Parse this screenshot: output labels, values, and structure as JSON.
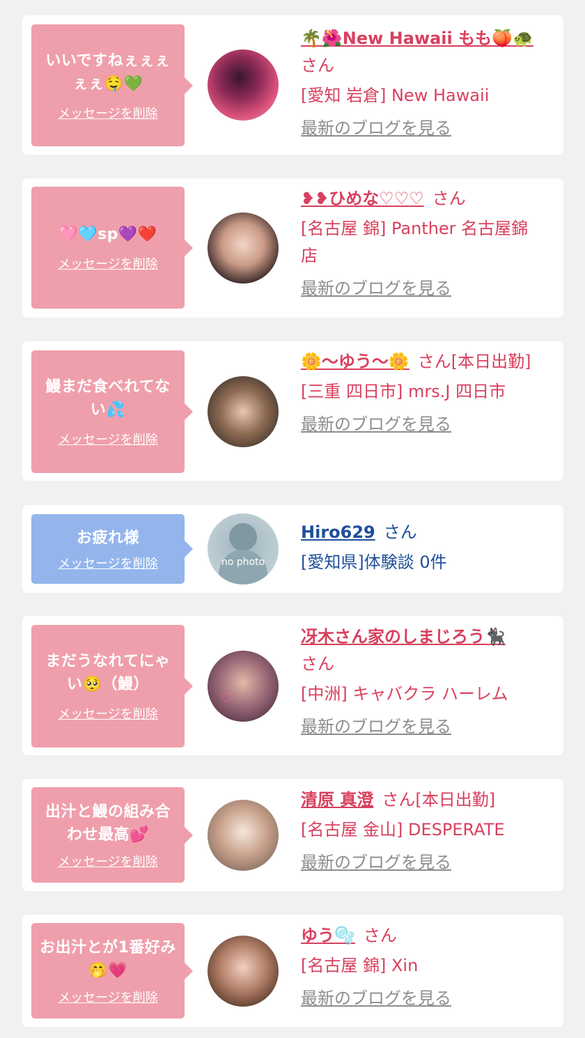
{
  "delete_label": "メッセージを削除",
  "blog_label": "最新のブログを見る",
  "san_label": "さん",
  "cards": [
    {
      "message": "いいですねぇぇぇぇぇ🤤💚",
      "name": "🌴🌺New Hawaii もも🍑🐢",
      "suffix": "さん",
      "shop": "[愛知 岩倉] New Hawaii",
      "bubble_color": "#ef9fab"
    },
    {
      "message": "🩷🩵sp💜❤️",
      "name": "❥❥ひめな♡♡♡",
      "suffix": "さん",
      "shop": "[名古屋 錦] Panther 名古屋錦店",
      "bubble_color": "#ef9fab"
    },
    {
      "message": "鰻まだ食べれてない💦",
      "name": "🌼〜ゆう〜🌼",
      "suffix": "さん[本日出勤]",
      "shop": "[三重 四日市] mrs.J 四日市",
      "bubble_color": "#ef9fab"
    },
    {
      "message": "お疲れ様",
      "name": "Hiro629",
      "suffix": "さん",
      "shop": "[愛知県]体験談 0件",
      "bubble_color": "#93b5ec",
      "avatar_text": "no photo"
    },
    {
      "message": "まだうなれてにゃい🥺（鰻）",
      "name": "冴木さん家のしまじろう🐈‍⬛",
      "suffix": "さん",
      "shop": "[中洲] キャバクラ ハーレム",
      "bubble_color": "#ef9fab"
    },
    {
      "message": "出汁と鰻の組み合わせ最高💕",
      "name": "清原 真澄",
      "suffix": "さん[本日出勤]",
      "shop": "[名古屋 金山] DESPERATE",
      "bubble_color": "#ef9fab"
    },
    {
      "message": "お出汁とが1番好み🤭💗",
      "name": "ゆう🫧",
      "suffix": "さん",
      "shop": "[名古屋 錦] Xin",
      "bubble_color": "#ef9fab"
    }
  ]
}
